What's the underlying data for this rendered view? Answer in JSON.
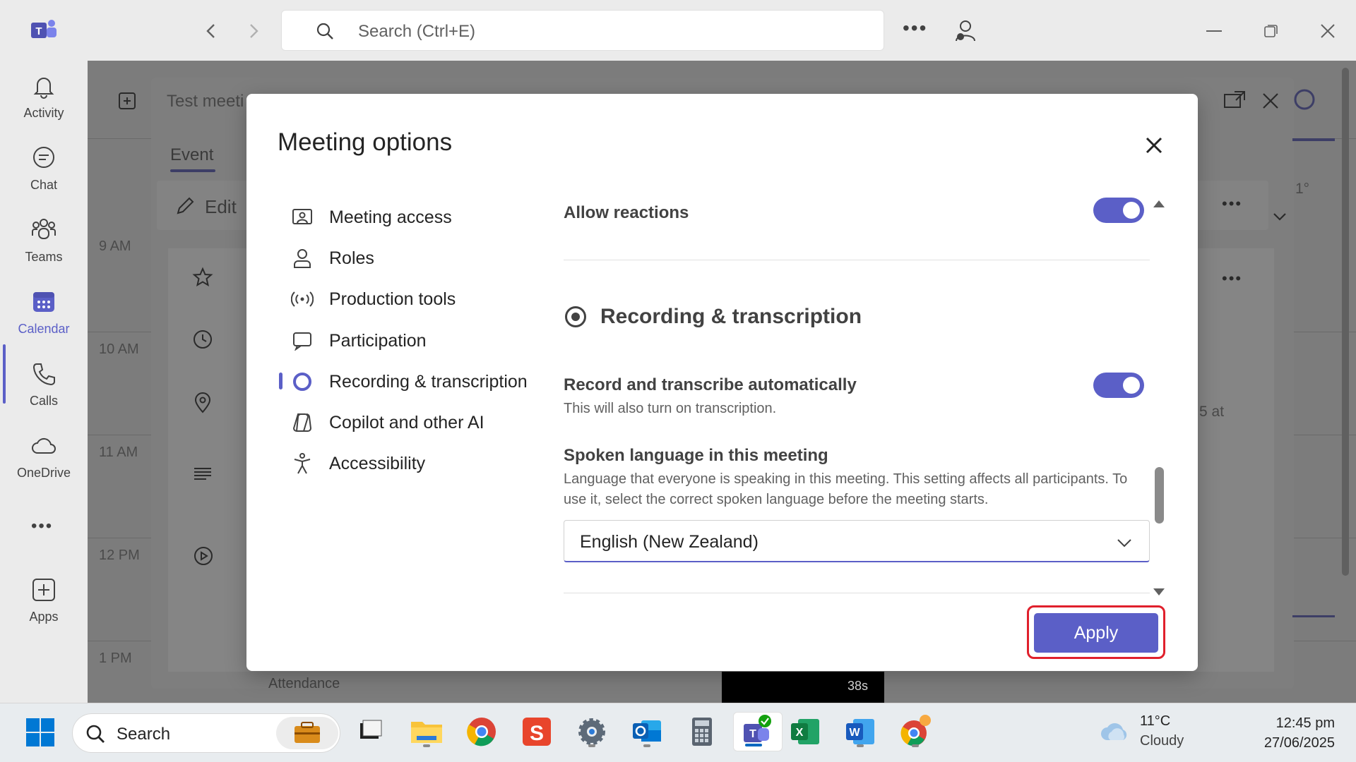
{
  "titlebar": {
    "search_placeholder": "Search (Ctrl+E)"
  },
  "rail": {
    "items": [
      {
        "label": "Activity",
        "icon": "bell-icon"
      },
      {
        "label": "Chat",
        "icon": "chat-icon"
      },
      {
        "label": "Teams",
        "icon": "teams-icon"
      },
      {
        "label": "Calendar",
        "icon": "calendar-icon",
        "active": true
      },
      {
        "label": "Calls",
        "icon": "phone-icon"
      },
      {
        "label": "OneDrive",
        "icon": "cloud-icon"
      },
      {
        "label": "Apps",
        "icon": "apps-icon"
      }
    ]
  },
  "background": {
    "event_title": "Test meeti",
    "tab_event": "Event",
    "edit_label": "Edit",
    "times": [
      "9 AM",
      "10 AM",
      "11 AM",
      "12 PM",
      "1 PM"
    ],
    "fragment_at": "5 at",
    "fragment_temp": "1°",
    "attendance": "Attendance",
    "video_time": "38s"
  },
  "dialog": {
    "title": "Meeting options",
    "menu": [
      {
        "label": "Meeting access",
        "icon": "meeting-access-icon"
      },
      {
        "label": "Roles",
        "icon": "person-icon"
      },
      {
        "label": "Production tools",
        "icon": "broadcast-icon"
      },
      {
        "label": "Participation",
        "icon": "participation-icon"
      },
      {
        "label": "Recording & transcription",
        "icon": "record-icon",
        "active": true
      },
      {
        "label": "Copilot and other AI",
        "icon": "copilot-icon"
      },
      {
        "label": "Accessibility",
        "icon": "accessibility-icon"
      }
    ],
    "allow_reactions": {
      "label": "Allow reactions",
      "on": true
    },
    "section_title": "Recording & transcription",
    "record_auto": {
      "label": "Record and transcribe automatically",
      "desc": "This will also turn on transcription.",
      "on": true
    },
    "spoken_language": {
      "label": "Spoken language in this meeting",
      "desc": "Language that everyone is speaking in this meeting. This setting affects all participants. To use it, select the correct spoken language before the meeting starts.",
      "value": "English (New Zealand)"
    },
    "apply_label": "Apply"
  },
  "taskbar": {
    "search_text": "Search",
    "weather_temp": "11°C",
    "weather_desc": "Cloudy",
    "time": "12:45 pm",
    "date": "27/06/2025"
  },
  "colors": {
    "accent": "#5b5fc7",
    "highlight": "#e0202c"
  }
}
